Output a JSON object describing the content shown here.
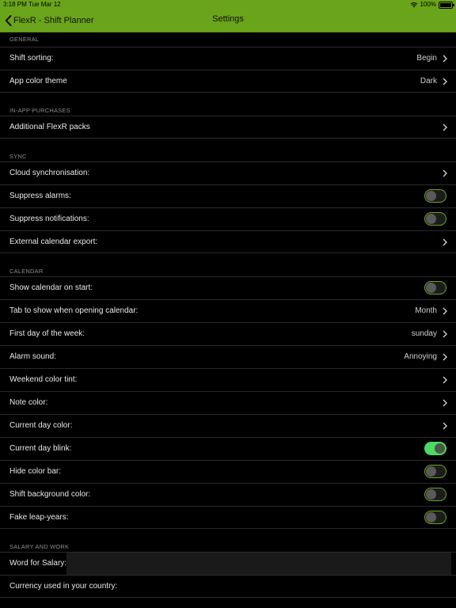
{
  "status_bar": {
    "time": "3:18 PM",
    "date": "Tue Mar 12",
    "battery": "100%"
  },
  "nav": {
    "back_label": "FlexR - Shift Planner",
    "title": "Settings"
  },
  "sections": {
    "general": {
      "header": "GENERAL",
      "shift_sorting": {
        "label": "Shift sorting:",
        "value": "Begin"
      },
      "app_color_theme": {
        "label": "App color theme",
        "value": "Dark"
      }
    },
    "iap": {
      "header": "IN-APP PURCHASES",
      "packs": {
        "label": "Additional FlexR packs"
      }
    },
    "sync": {
      "header": "SYNC",
      "cloud": {
        "label": "Cloud synchronisation:"
      },
      "suppress_alarms": {
        "label": "Suppress alarms:",
        "on": false
      },
      "suppress_notifications": {
        "label": "Suppress notifications:",
        "on": false
      },
      "export": {
        "label": "External calendar export:"
      }
    },
    "calendar": {
      "header": "CALENDAR",
      "show_on_start": {
        "label": "Show calendar on start:",
        "on": false
      },
      "tab_on_open": {
        "label": "Tab to show when opening calendar:",
        "value": "Month"
      },
      "first_day": {
        "label": "First day of the week:",
        "value": "sunday"
      },
      "alarm_sound": {
        "label": "Alarm sound:",
        "value": "Annoying"
      },
      "weekend_tint": {
        "label": "Weekend color tint:"
      },
      "note_color": {
        "label": "Note color:"
      },
      "current_day_color": {
        "label": "Current day color:"
      },
      "current_day_blink": {
        "label": "Current day blink:",
        "on": true
      },
      "hide_color_bar": {
        "label": "Hide color bar:",
        "on": false
      },
      "shift_bg_color": {
        "label": "Shift background color:",
        "on": false
      },
      "fake_leap_years": {
        "label": "Fake leap-years:",
        "on": false
      }
    },
    "salary": {
      "header": "SALARY AND WORK",
      "word_for_salary": {
        "label": "Word for Salary:",
        "value": ""
      },
      "currency": {
        "label": "Currency used in your country:",
        "value": ""
      }
    }
  },
  "colors": {
    "accent": "#6aa41a",
    "toggle_on": "#4cd964",
    "background": "#000000"
  },
  "icons": {
    "back": "chevron-left-icon",
    "disclosure": "chevron-right-icon"
  }
}
